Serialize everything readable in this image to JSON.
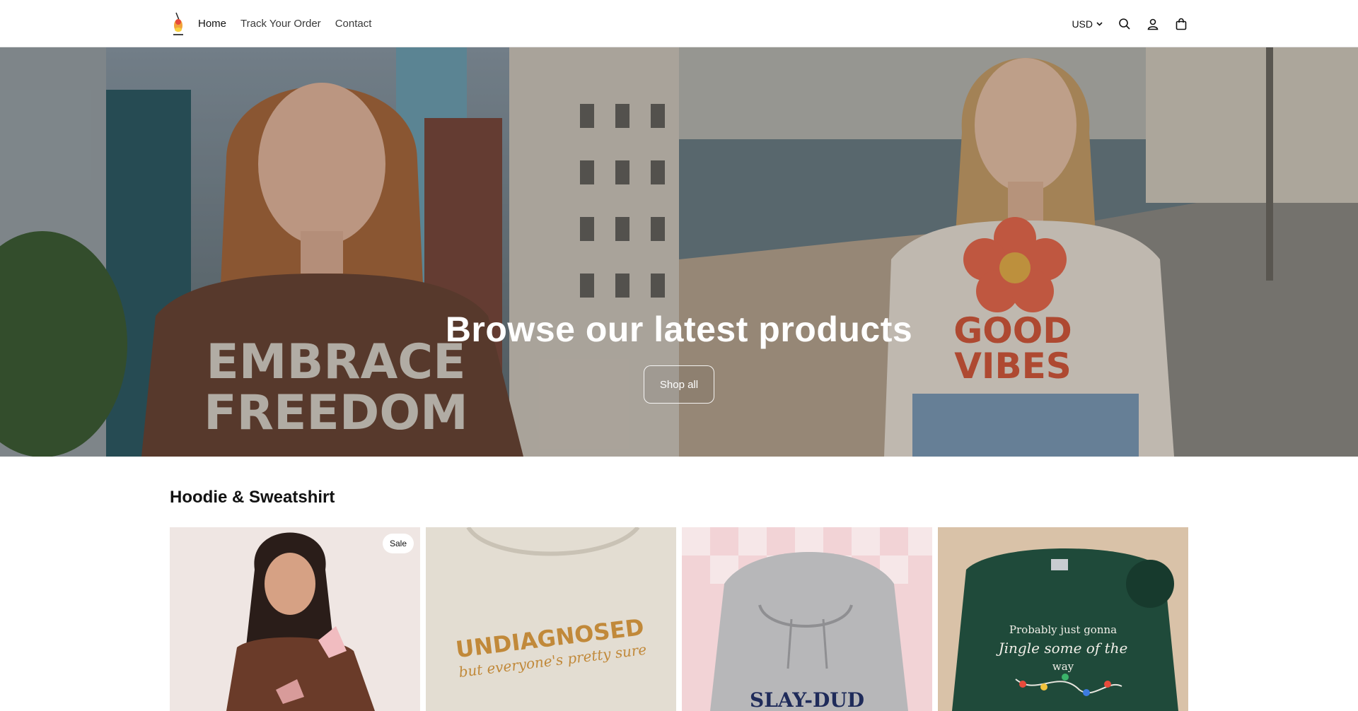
{
  "header": {
    "nav": [
      {
        "label": "Home"
      },
      {
        "label": "Track Your Order"
      },
      {
        "label": "Contact"
      }
    ],
    "currency": "USD",
    "icons": [
      "search-icon",
      "account-icon",
      "cart-icon",
      "chevron-down-icon"
    ]
  },
  "hero": {
    "title": "Browse our latest products",
    "button_label": "Shop all",
    "left_shirt_text": [
      "EMBRACE",
      "FREEDOM"
    ],
    "right_shirt_text": [
      "GOOD",
      "VIBES"
    ]
  },
  "collection": {
    "title": "Hoodie & Sweatshirt",
    "sale_badge": "Sale",
    "products": [
      {
        "image_text": []
      },
      {
        "image_text": [
          "UNDIAGNOSED",
          "but everyone's pretty sure"
        ]
      },
      {
        "image_text": [
          "SLAY-DUD"
        ]
      },
      {
        "image_text": [
          "Probably just gonna",
          "Jingle some of the",
          "way"
        ]
      }
    ]
  },
  "colors": {
    "accent_text": "#121212",
    "hero_brown": "#6b4636",
    "hero_cream": "#e9e1d6",
    "good_vibes": "#d55a3c",
    "card_green": "#1f4a3a"
  }
}
